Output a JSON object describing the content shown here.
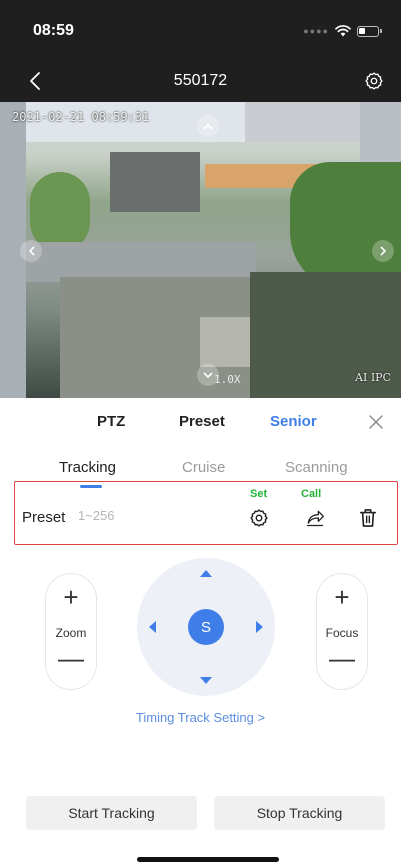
{
  "status_bar": {
    "time": "08:59"
  },
  "nav": {
    "title": "550172"
  },
  "video": {
    "timestamp": "2021-02-21 08:59:31",
    "zoom": "1.0X",
    "watermark": "AI IPC"
  },
  "tabs": [
    {
      "label": "PTZ"
    },
    {
      "label": "Preset"
    },
    {
      "label": "Senior"
    }
  ],
  "subtabs": [
    {
      "label": "Tracking"
    },
    {
      "label": "Cruise"
    },
    {
      "label": "Scanning"
    }
  ],
  "preset": {
    "label": "Preset",
    "placeholder": "1~256",
    "set_label": "Set",
    "call_label": "Call"
  },
  "zoom": {
    "label": "Zoom",
    "plus": "+",
    "minus": "—"
  },
  "focus": {
    "label": "Focus",
    "plus": "+",
    "minus": "—"
  },
  "joystick": {
    "center_label": "S"
  },
  "timing_link": "Timing Track Setting >",
  "buttons": {
    "start": "Start Tracking",
    "stop": "Stop Tracking"
  },
  "colors": {
    "accent": "#3f7ee8",
    "set_call_green": "#21b336",
    "highlight_border": "#e04545"
  },
  "icons": {
    "back": "chevron-left-icon",
    "settings": "gear-icon",
    "close": "close-icon",
    "set": "gear-icon",
    "call": "share-arrow-icon",
    "delete": "trash-icon"
  }
}
